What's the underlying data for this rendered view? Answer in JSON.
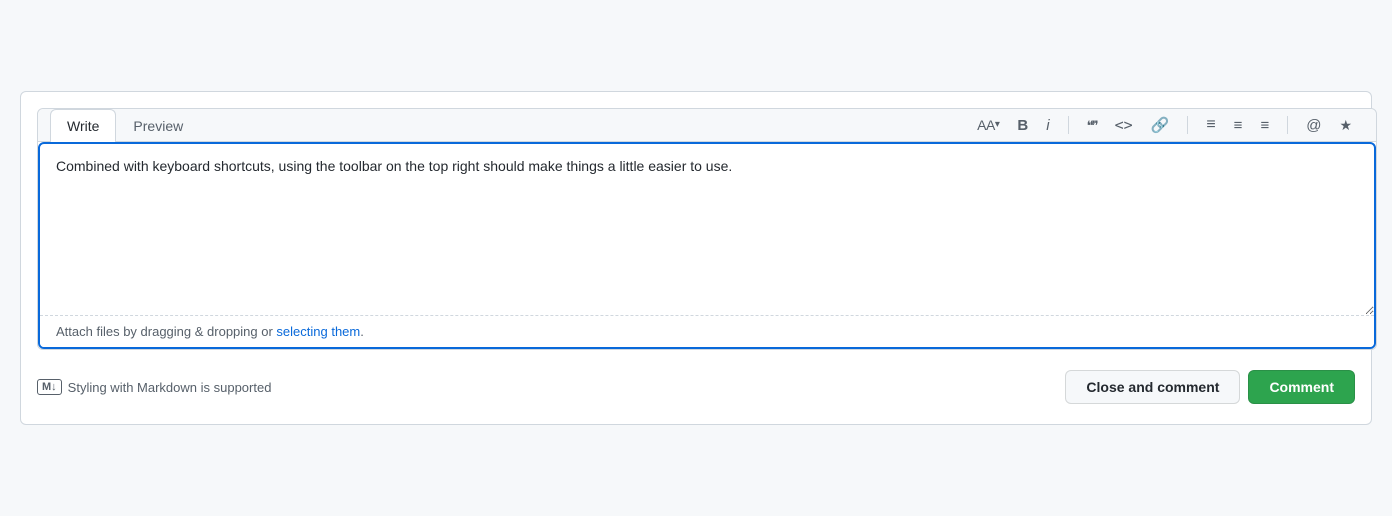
{
  "tabs": [
    {
      "id": "write",
      "label": "Write",
      "active": true
    },
    {
      "id": "preview",
      "label": "Preview",
      "active": false
    }
  ],
  "toolbar": {
    "font_size_label": "AA",
    "font_size_arrow": "▾",
    "bold_label": "B",
    "italic_label": "i",
    "quote_label": "❝❞",
    "code_label": "<>",
    "link_label": "🔗",
    "unordered_list_label": "≡",
    "ordered_list_label": "≡",
    "task_list_label": "≡",
    "mention_label": "@",
    "bookmark_label": "★"
  },
  "textarea": {
    "value": "Combined with keyboard shortcuts, using the toolbar on the top right should make things a little easier to use.",
    "placeholder": ""
  },
  "attach": {
    "text_before": "Attach files by dragging & dropping or ",
    "link_text": "selecting them",
    "text_after": "."
  },
  "footer": {
    "markdown_icon": "M↓",
    "markdown_text": "Styling with Markdown is supported",
    "close_and_comment_label": "Close and comment",
    "comment_label": "Comment"
  }
}
